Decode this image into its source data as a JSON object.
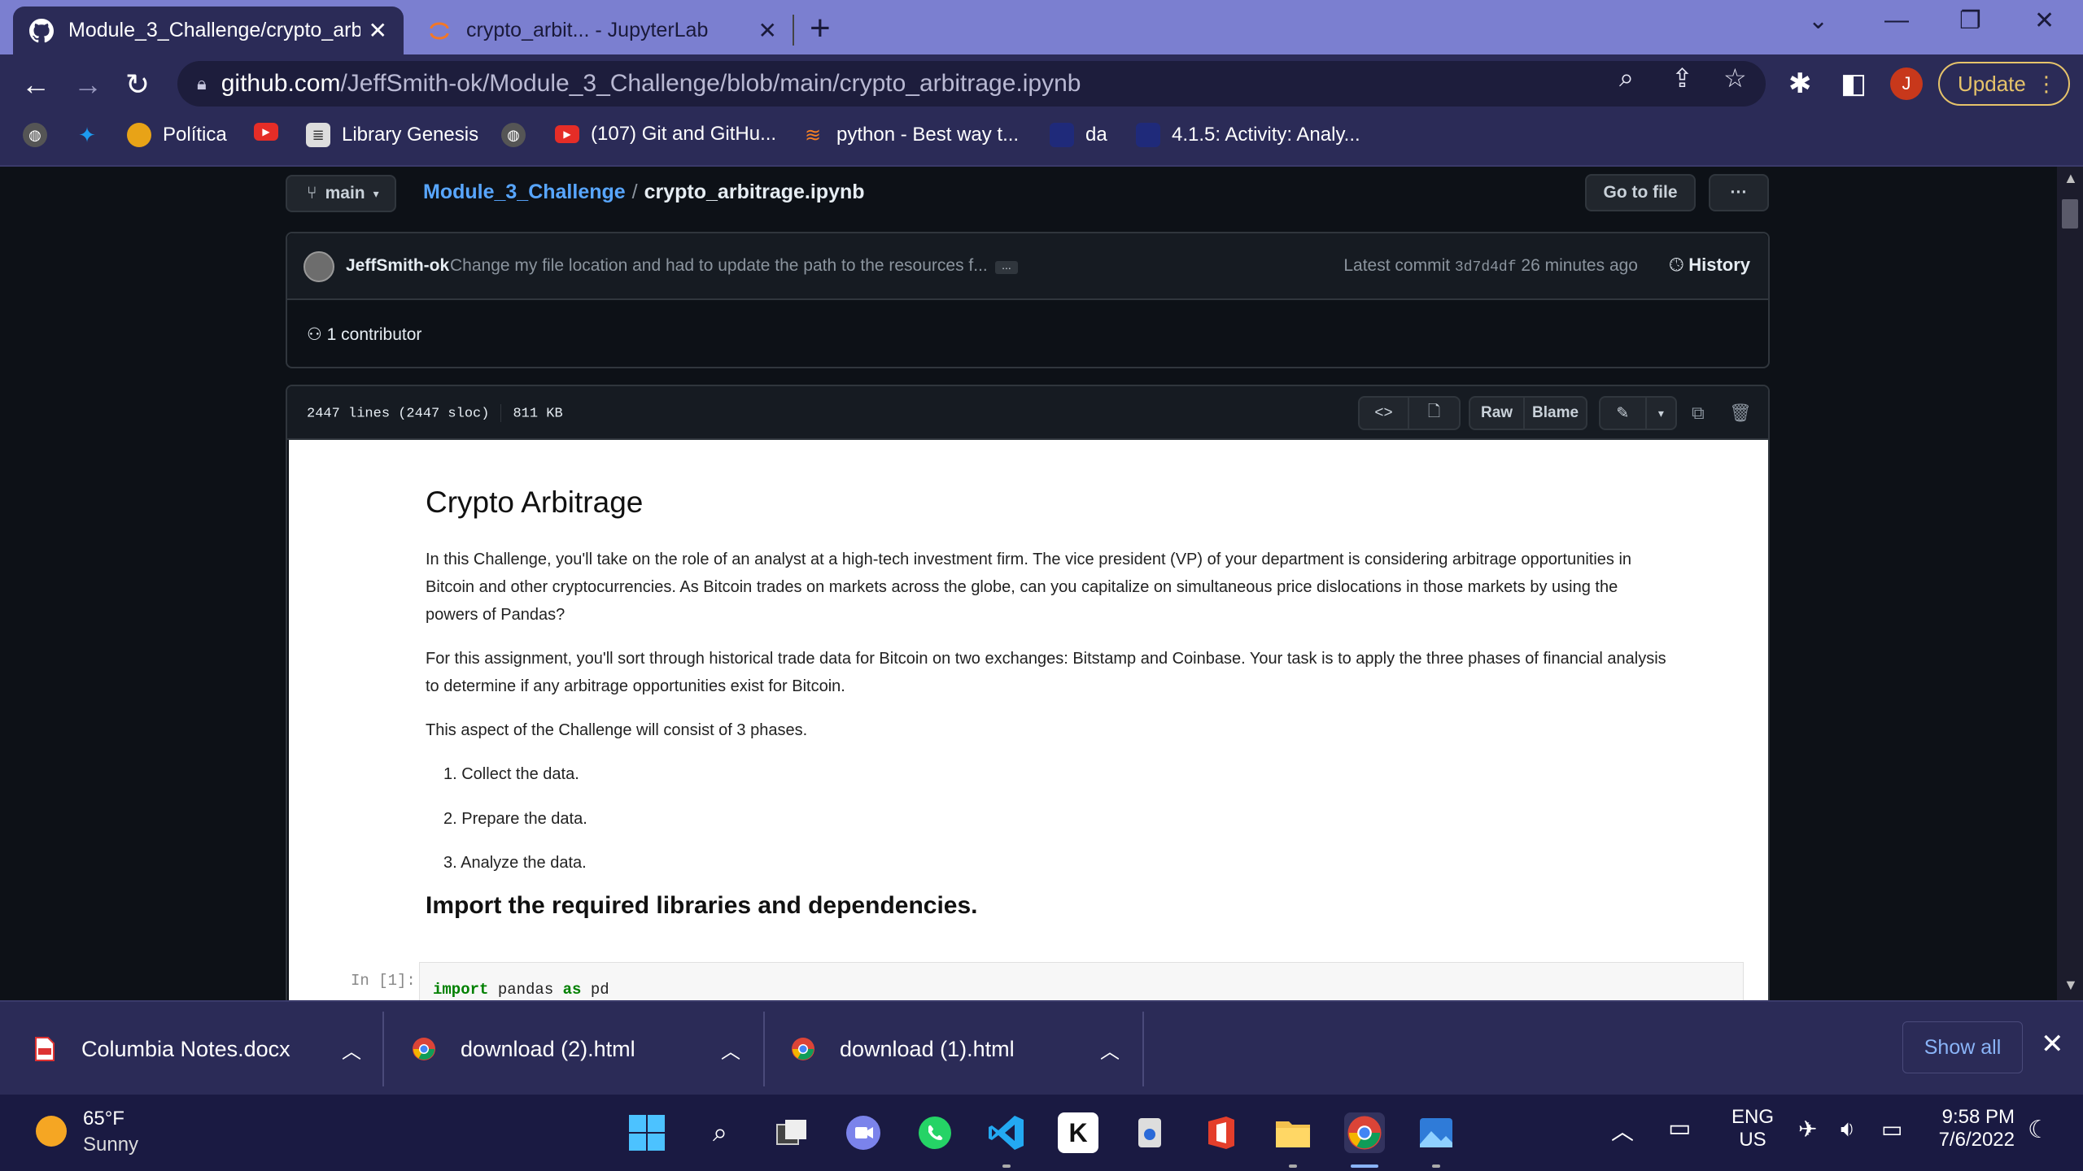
{
  "browser": {
    "tabs": [
      {
        "title": "Module_3_Challenge/crypto_arbi",
        "active": true
      },
      {
        "title": "crypto_arbit... - JupyterLab",
        "active": false
      }
    ],
    "new_tab": "+",
    "url_host": "github.com",
    "url_path": "/JeffSmith-ok/Module_3_Challenge/blob/main/crypto_arbitrage.ipynb",
    "profile_initial": "J",
    "update_label": "Update",
    "bookmarks": [
      {
        "label": "",
        "icon": "globe-icon"
      },
      {
        "label": "",
        "icon": "twitter-icon"
      },
      {
        "label": "Política",
        "icon": "politica-icon"
      },
      {
        "label": "",
        "icon": "youtube-icon"
      },
      {
        "label": "Library Genesis",
        "icon": "library-icon"
      },
      {
        "label": "",
        "icon": "globe-icon"
      },
      {
        "label": "(107) Git and GitHu...",
        "icon": "youtube-icon"
      },
      {
        "label": "python - Best way t...",
        "icon": "stackoverflow-icon"
      },
      {
        "label": "da",
        "icon": "bookmark-icon"
      },
      {
        "label": "4.1.5: Activity: Analy...",
        "icon": "bookmark-icon"
      }
    ]
  },
  "github": {
    "branch": "main",
    "repo": "Module_3_Challenge",
    "separator": "/",
    "file": "crypto_arbitrage.ipynb",
    "go_to_file": "Go to file",
    "more": "···",
    "commit": {
      "author": "JeffSmith-ok",
      "message": "Change my file location and had to update the path to the resources f...",
      "ellipsis": "...",
      "latest_label": "Latest commit",
      "sha": "3d7d4df",
      "time": "26 minutes ago",
      "history": "History"
    },
    "contributors": "1 contributor",
    "file_meta": {
      "lines": "2447 lines (2447 sloc)",
      "size": "811 KB"
    },
    "toolbar": {
      "raw": "Raw",
      "blame": "Blame"
    }
  },
  "notebook": {
    "title": "Crypto Arbitrage",
    "para1_line1": "In this Challenge, you'll take on the role of an analyst at a high-tech investment firm. The vice president (VP) of your department is considering arbitrage opportunities in",
    "para1_line2": "Bitcoin and other cryptocurrencies. As Bitcoin trades on markets across the globe, can you capitalize on simultaneous price dislocations in those markets by using the",
    "para1_line3": "powers of Pandas?",
    "para2_line1": "For this assignment, you'll sort through historical trade data for Bitcoin on two exchanges: Bitstamp and Coinbase. Your task is to apply the three phases of financial analysis",
    "para2_line2": "to determine if any arbitrage opportunities exist for Bitcoin.",
    "para3": "This aspect of the Challenge will consist of 3 phases.",
    "list": [
      "1. Collect the data.",
      "2. Prepare the data.",
      "3. Analyze the data."
    ],
    "heading2": "Import the required libraries and dependencies.",
    "cell_prompt": "In [1]:",
    "code_kw1": "import",
    "code_mod": " pandas ",
    "code_kw2": "as",
    "code_alias": " pd"
  },
  "downloads": {
    "items": [
      {
        "name": "Columbia Notes.docx"
      },
      {
        "name": "download (2).html"
      },
      {
        "name": "download (1).html"
      }
    ],
    "show_all": "Show all"
  },
  "taskbar": {
    "weather_temp": "65°F",
    "weather_cond": "Sunny",
    "lang1": "ENG",
    "lang2": "US",
    "time": "9:58 PM",
    "date": "7/6/2022"
  },
  "colors": {
    "tab_bar": "#7b7fd0",
    "chrome": "#2b2b57",
    "github_bg": "#0d1117",
    "link": "#58a6ff",
    "update_accent": "#e6c36a"
  }
}
